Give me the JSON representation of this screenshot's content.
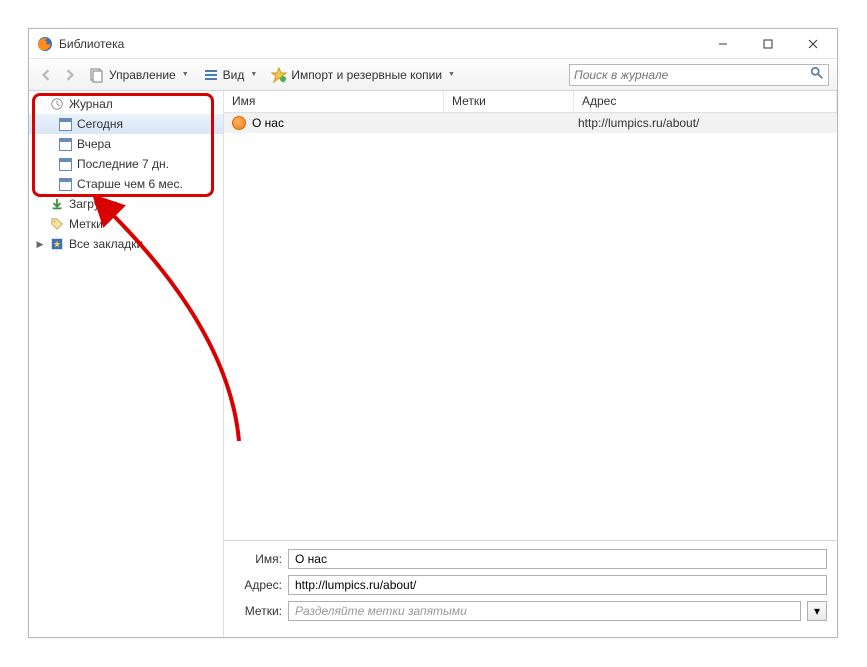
{
  "window": {
    "title": "Библиотека"
  },
  "toolbar": {
    "manage": "Управление",
    "view": "Вид",
    "import": "Импорт и резервные копии",
    "search_placeholder": "Поиск в журнале"
  },
  "sidebar": {
    "history": "Журнал",
    "today": "Сегодня",
    "yesterday": "Вчера",
    "last7": "Последние 7 дн.",
    "older6m": "Старше чем 6 мес.",
    "downloads": "Загрузки",
    "tags": "Метки",
    "all_bookmarks": "Все закладки"
  },
  "columns": {
    "name": "Имя",
    "tags": "Метки",
    "address": "Адрес"
  },
  "rows": [
    {
      "name": "О нас",
      "tags": "",
      "address": "http://lumpics.ru/about/"
    }
  ],
  "details": {
    "name_label": "Имя:",
    "name_value": "О нас",
    "address_label": "Адрес:",
    "address_value": "http://lumpics.ru/about/",
    "tags_label": "Метки:",
    "tags_placeholder": "Разделяйте метки запятыми"
  }
}
